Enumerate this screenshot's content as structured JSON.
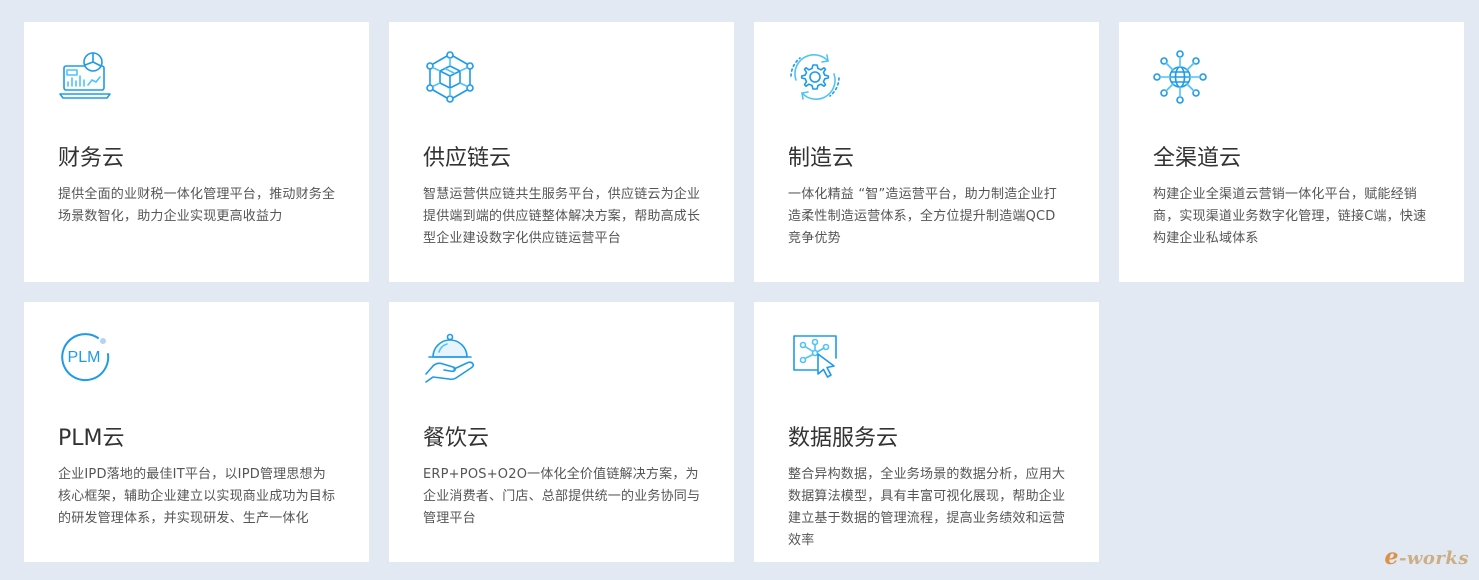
{
  "colors": {
    "background": "#e3e9f3",
    "card": "#ffffff",
    "icon_accent": "#1e9be8",
    "title": "#333333",
    "text": "#555555"
  },
  "cards": [
    {
      "icon": "finance-laptop-chart-icon",
      "title": "财务云",
      "desc": "提供全面的业财税一体化管理平台，推动财务全场景数智化，助力企业实现更高收益力"
    },
    {
      "icon": "supply-chain-cube-network-icon",
      "title": "供应链云",
      "desc": "智慧运营供应链共生服务平台，供应链云为企业提供端到端的供应链整体解决方案，帮助高成长型企业建设数字化供应链运营平台"
    },
    {
      "icon": "manufacturing-gear-cycle-icon",
      "title": "制造云",
      "desc": "一体化精益 “智”造运营平台，助力制造企业打造柔性制造运营体系，全方位提升制造端QCD竞争优势"
    },
    {
      "icon": "omnichannel-globe-network-icon",
      "title": "全渠道云",
      "desc": "构建企业全渠道云营销一体化平台，赋能经销商，实现渠道业务数字化管理，链接C端，快速构建企业私域体系"
    },
    {
      "icon": "plm-circle-icon",
      "icon_text": "PLM",
      "title": "PLM云",
      "desc": "企业IPD落地的最佳IT平台，以IPD管理思想为核心框架，辅助企业建立以实现商业成功为目标的研发管理体系，并实现研发、生产一体化"
    },
    {
      "icon": "catering-cloche-hand-icon",
      "title": "餐饮云",
      "desc": "ERP+POS+O2O一体化全价值链解决方案，为企业消费者、门店、总部提供统一的业务协同与管理平台"
    },
    {
      "icon": "data-service-screen-cursor-icon",
      "title": "数据服务云",
      "desc": "整合异构数据，全业务场景的数据分析，应用大数据算法模型，具有丰富可视化展现，帮助企业建立基于数据的管理流程，提高业务绩效和运营效率"
    }
  ],
  "watermark": {
    "prefix": "e",
    "text": "-works"
  }
}
